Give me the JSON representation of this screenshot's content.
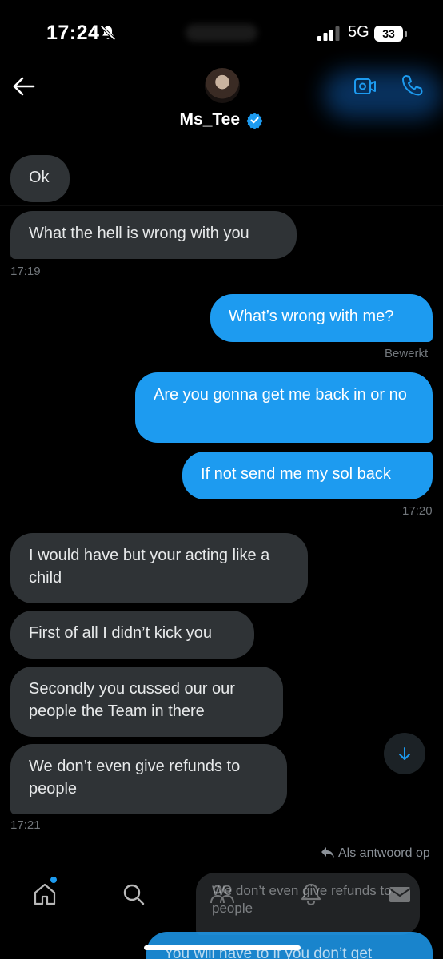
{
  "status_bar": {
    "time": "17:24",
    "network": "5G",
    "battery": "33"
  },
  "header": {
    "contact_name": "Ms_Tee"
  },
  "messages": [
    {
      "text": "Ok",
      "dir": "in"
    },
    {
      "text": "What the hell is wrong with you",
      "dir": "in"
    },
    {
      "text": "What’s wrong with me?",
      "dir": "out"
    },
    {
      "text": "Are you gonna get me back in or no",
      "dir": "out"
    },
    {
      "text": "If not send me my sol back",
      "dir": "out"
    },
    {
      "text": "I would have but your acting like a child",
      "dir": "in"
    },
    {
      "text": "First of all I didn’t kick you",
      "dir": "in"
    },
    {
      "text": "Secondly you cussed our our people the Team in there",
      "dir": "in"
    },
    {
      "text": "We don’t even give refunds to people",
      "dir": "in"
    }
  ],
  "timestamps": [
    "17:19",
    "17:20",
    "17:21"
  ],
  "edited_label": "Bewerkt",
  "reply_hint": "Als antwoord op",
  "overlay": {
    "quoted_text": "We don’t even give refunds to people",
    "draft_text": "You will have to if you don’t get"
  },
  "colors": {
    "incoming": "#2f3336",
    "outgoing": "#1d9bf0",
    "background": "#000000"
  },
  "icons": [
    "back-arrow-icon",
    "verified-badge-icon",
    "video-call-icon",
    "phone-icon",
    "scroll-down-arrow-icon",
    "reply-arrow-icon",
    "home-icon",
    "search-icon",
    "communities-icon",
    "notifications-icon",
    "messages-icon"
  ]
}
